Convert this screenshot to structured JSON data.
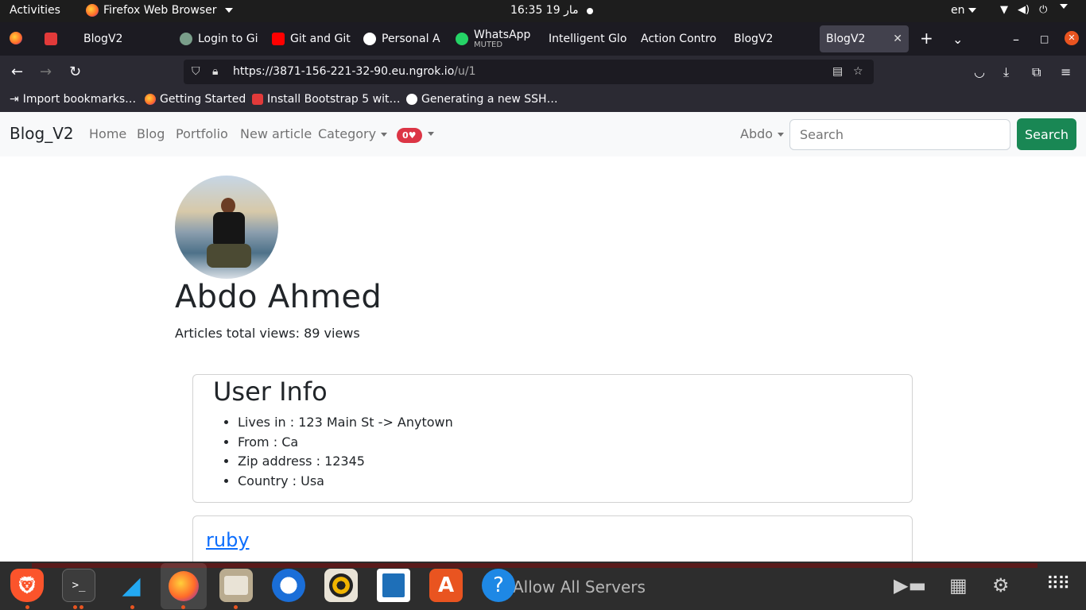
{
  "system": {
    "activities": "Activities",
    "app_name": "Firefox Web Browser",
    "clock": "16:35  19 مار",
    "lang": "en"
  },
  "tabs": [
    {
      "label": "BlogV2",
      "favicon_color": "#e23a3a"
    },
    {
      "label": "Login to Gi",
      "favicon_color": "#7a9e8a"
    },
    {
      "label": "Git and Git",
      "favicon_color": "#ff0000"
    },
    {
      "label": "Personal A",
      "favicon_color": "#ffffff"
    },
    {
      "label": "WhatsApp",
      "sub": "MUTED",
      "favicon_color": "#25d366"
    },
    {
      "label": "Intelligent Glo",
      "favicon_color": "#1c1b22"
    },
    {
      "label": "Action Contro",
      "favicon_color": "#1c1b22"
    },
    {
      "label": "BlogV2",
      "favicon_color": "#1c1b22"
    },
    {
      "label": "BlogV2",
      "favicon_color": "#1c1b22",
      "active": true
    }
  ],
  "urlbar": {
    "url_main": "https://3871-156-221-32-90.eu.ngrok.io",
    "url_path": "/u/1"
  },
  "bookmarks": [
    "Import bookmarks…",
    "Getting Started",
    "Install Bootstrap 5 wit…",
    "Generating a new SSH…"
  ],
  "site": {
    "brand": "Blog_V2",
    "nav": [
      "Home",
      "Blog",
      "Portfolio",
      "New article",
      "Category"
    ],
    "likes_count": "0",
    "heart": "♥",
    "user_menu": "Abdo",
    "search_placeholder": "Search",
    "search_button": "Search"
  },
  "profile": {
    "name": "Abdo Ahmed",
    "views": "Articles total views: 89 views"
  },
  "user_info": {
    "title": "User Info",
    "items": [
      "Lives in : 123 Main St -> Anytown",
      "From : Ca",
      "Zip address : 12345",
      "Country : Usa"
    ]
  },
  "posts": [
    {
      "title": "ruby"
    }
  ],
  "dock": {
    "ghost_text": "Allow All Servers",
    "icons": [
      "brave-icon",
      "terminal-icon",
      "vscode-icon",
      "firefox-icon",
      "files-icon",
      "thunderbird-icon",
      "rhythmbox-icon",
      "writer-icon",
      "app-center-icon",
      "help-icon",
      "app-grid-icon"
    ]
  },
  "colors": {
    "search_button": "#198754",
    "link": "#0d6efd",
    "badge": "#dc3545"
  }
}
